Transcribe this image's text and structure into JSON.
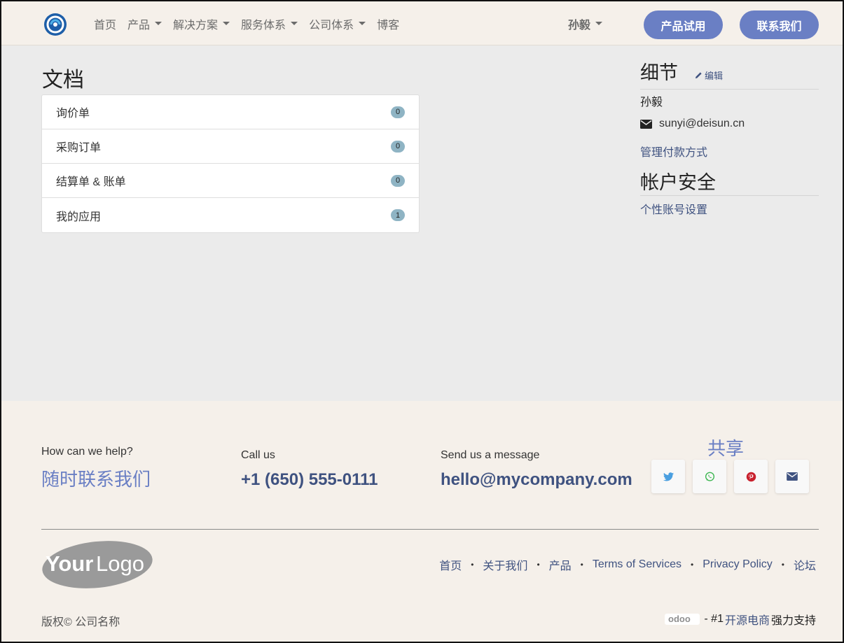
{
  "header": {
    "nav": [
      {
        "label": "首页",
        "dropdown": false
      },
      {
        "label": "产品",
        "dropdown": true
      },
      {
        "label": "解决方案",
        "dropdown": true
      },
      {
        "label": "服务体系",
        "dropdown": true
      },
      {
        "label": "公司体系",
        "dropdown": true
      },
      {
        "label": "博客",
        "dropdown": false
      }
    ],
    "user_name": "孙毅",
    "trial_label": "产品试用",
    "contact_label": "联系我们"
  },
  "documents": {
    "title": "文档",
    "items": [
      {
        "label": "询价单",
        "count": "0"
      },
      {
        "label": "采购订单",
        "count": "0"
      },
      {
        "label": "结算单 & 账单",
        "count": "0"
      },
      {
        "label": "我的应用",
        "count": "1"
      }
    ]
  },
  "details": {
    "title": "细节",
    "edit_label": "编辑",
    "name": "孙毅",
    "email": "sunyi@deisun.cn",
    "payment_link": "管理付款方式",
    "security_title": "帐户安全",
    "account_settings_link": "个性账号设置"
  },
  "footer": {
    "help_small": "How can we help?",
    "help_big": "随时联系我们",
    "call_small": "Call us",
    "call_big": "+1 (650) 555-0111",
    "message_small": "Send us a message",
    "message_big": "hello@mycompany.com",
    "share_title": "共享",
    "share_icons": [
      "twitter-icon",
      "whatsapp-icon",
      "pinterest-icon",
      "envelope-icon"
    ],
    "logo_text_your": "Your",
    "logo_text_logo": "Logo",
    "links": [
      "首页",
      "关于我们",
      "产品",
      "Terms of Services",
      "Privacy Policy",
      "论坛"
    ],
    "copyright": "版权© 公司名称",
    "powered_brand": "odoo",
    "powered_prefix": "- #1",
    "powered_link": "开源电商",
    "powered_suffix": "强力支持"
  },
  "colors": {
    "accent": "#6a7fc4",
    "link": "#3f5280",
    "header_bg": "#f5f0ea",
    "page_bg": "#ebebeb",
    "badge": "#8fb4c4"
  }
}
